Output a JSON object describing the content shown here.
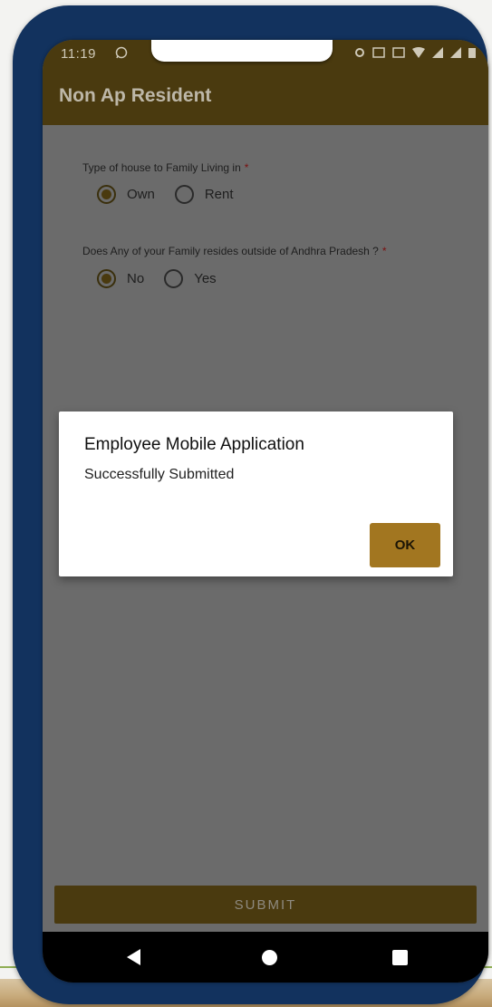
{
  "status_bar": {
    "time": "11:19",
    "chat_icon": "whatsapp-icon",
    "icons": [
      "vpn-icon",
      "sim-icon",
      "sim-icon",
      "wifi-icon",
      "signal-icon",
      "signal-icon",
      "battery-icon"
    ]
  },
  "app_bar": {
    "title": "Non Ap Resident"
  },
  "form": {
    "q1": {
      "label": "Type of house to Family Living in",
      "required_mark": "*",
      "options": [
        "Own",
        "Rent"
      ],
      "selected": "Own"
    },
    "q2": {
      "label": "Does Any of your Family resides outside of Andhra Pradesh ?",
      "required_mark": "*",
      "options": [
        "No",
        "Yes"
      ],
      "selected": "No"
    }
  },
  "submit_label": "SUBMIT",
  "dialog": {
    "title": "Employee Mobile Application",
    "message": "Successfully Submitted",
    "ok_label": "OK"
  },
  "nav_bar": {
    "icons": [
      "back-icon",
      "home-icon",
      "recents-icon"
    ]
  },
  "colors": {
    "phone_frame": "#12325e",
    "app_bar": "#4a3a0f",
    "ok_button": "#a27620",
    "scrim": "#6b6b6b"
  }
}
